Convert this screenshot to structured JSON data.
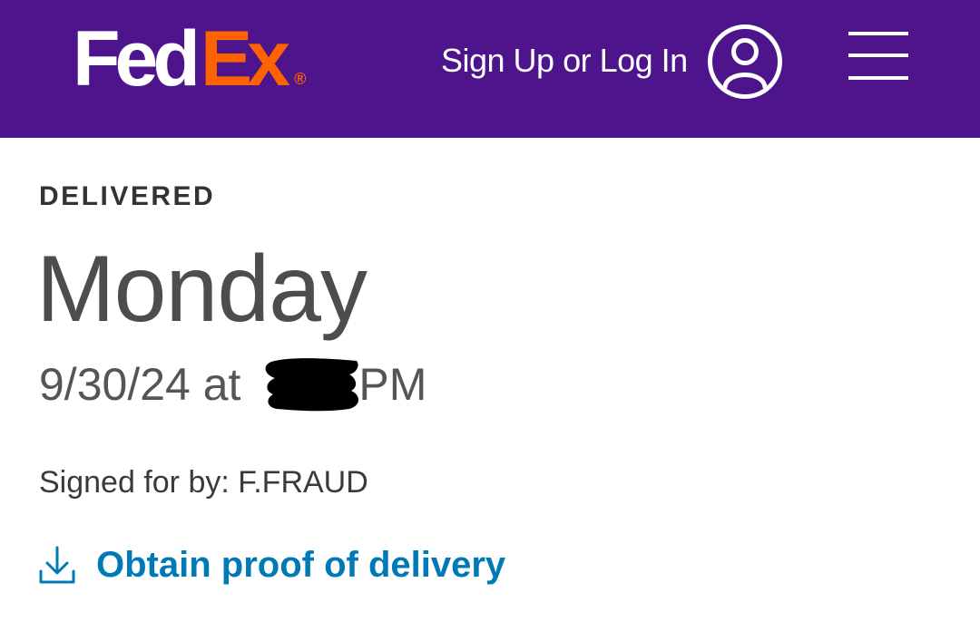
{
  "header": {
    "logo": {
      "part1": "Fed",
      "part2": "Ex",
      "mark": "®"
    },
    "signin_label": "Sign Up or Log In",
    "account_icon": "user-circle-icon",
    "menu_icon": "hamburger-menu-icon"
  },
  "shipment": {
    "status": "DELIVERED",
    "day": "Monday",
    "date_prefix": "9/30/24 at",
    "time_suffix": "PM",
    "signed_for": "Signed for by: F.FRAUD",
    "pod_label": "Obtain proof of delivery",
    "pod_icon": "download-icon"
  },
  "colors": {
    "header_bg": "#4d148c",
    "brand_orange": "#ff6200",
    "link_blue": "#007ab7"
  }
}
